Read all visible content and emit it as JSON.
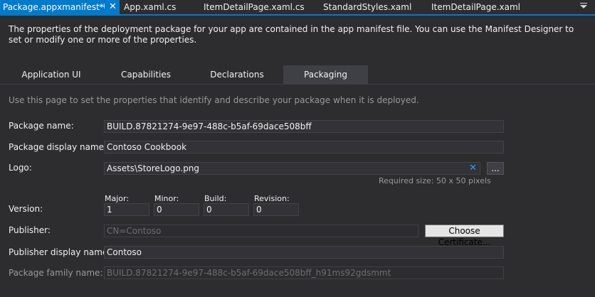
{
  "document_tabs": [
    {
      "label": "Package.appxmanifest*",
      "active": true
    },
    {
      "label": "App.xaml.cs",
      "active": false
    },
    {
      "label": "ItemDetailPage.xaml.cs",
      "active": false
    },
    {
      "label": "StandardStyles.xaml",
      "active": false
    },
    {
      "label": "ItemDetailPage.xaml",
      "active": false
    }
  ],
  "active_tab_icons": {
    "pin": "⊣",
    "close": "✕"
  },
  "intro_text": "The properties of the deployment package for your app are contained in the app manifest file. You can use the Manifest Designer to set or modify one or more of the properties.",
  "section_tabs": [
    {
      "label": "Application UI"
    },
    {
      "label": "Capabilities"
    },
    {
      "label": "Declarations"
    },
    {
      "label": "Packaging",
      "active": true
    }
  ],
  "hint_text": "Use this page to set the properties that identify and describe your package when it is deployed.",
  "form": {
    "package_name": {
      "label": "Package name:",
      "value": "BUILD.87821274-9e97-488c-b5af-69dace508bff"
    },
    "package_display_name": {
      "label": "Package display name:",
      "value": "Contoso Cookbook"
    },
    "logo": {
      "label": "Logo:",
      "value": "Assets\\StoreLogo.png",
      "clear_icon": "✕",
      "browse_label": "...",
      "required_size": "Required size: 50 x 50 pixels"
    },
    "version": {
      "label": "Version:",
      "major_label": "Major:",
      "major": "1",
      "minor_label": "Minor:",
      "minor": "0",
      "build_label": "Build:",
      "build": "0",
      "revision_label": "Revision:",
      "revision": "0"
    },
    "publisher": {
      "label": "Publisher:",
      "value": "CN=Contoso",
      "button_label": "Choose Certificate..."
    },
    "publisher_display_name": {
      "label": "Publisher display name:",
      "value": "Contoso"
    },
    "package_family_name": {
      "label": "Package family name:",
      "value": "BUILD.87821274-9e97-488c-b5af-69dace508bff_h91ms92gdsmmt"
    }
  },
  "colors": {
    "accent": "#007acc",
    "background": "#2d2d30",
    "field": "#333337",
    "link_blue": "#3399ff"
  }
}
